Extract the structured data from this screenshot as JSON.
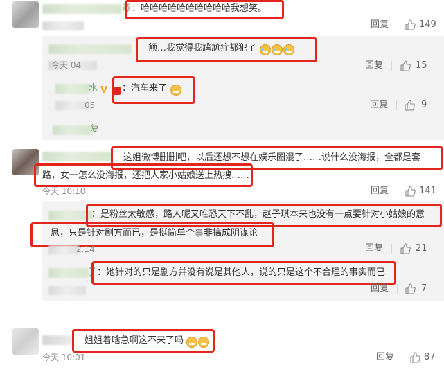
{
  "actions": {
    "reply_label": "回复"
  },
  "colors": {
    "highlight_box": "#e2261e",
    "time_text": "#8d8d8d",
    "name_green": "#6a9a5b"
  },
  "comments": [
    {
      "name_tail": "意",
      "text": "：哈哈哈哈哈哈哈哈哈哈我想笑。",
      "likes": "149"
    },
    {
      "text_line1": "这姐微博删删吧，以后还想不想在娱乐圈混了……说什么没海报，全都是套",
      "text_line2": "路，女一怎么没海报，还把人家小姑娘送上热搜……",
      "time": "今天 10:10",
      "likes": "141"
    },
    {
      "text": "姐姐着啥急啊这不来了吗",
      "time": "今天 10:01",
      "likes": "87"
    }
  ],
  "replies_1": [
    {
      "text": "额…我觉得我尴尬症都犯了",
      "time_fragment": "今天 04",
      "likes": "15"
    },
    {
      "name_tail": "水",
      "v_badge": "V",
      "text": "：汽车来了",
      "time_fragment": "05",
      "likes": "9"
    }
  ],
  "replies_1_more": "复",
  "replies_2": [
    {
      "text_line1": "：是粉丝太敏感，路人呢又唯恐天下不乱，赵子琪本来也没有一点要针对小姑娘的意",
      "text_line2": "思，只是针对剧方而已，是挺简单个事非搞成阴谋论",
      "time_fragment": "2.14",
      "likes": "21"
    },
    {
      "name_tail": "子",
      "text": "：她针对的只是剧方并没有说是其他人，说的只是这个不合理的事实而已",
      "likes": "7"
    }
  ],
  "icons": {
    "like": "thumbs-up-icon",
    "emoji_cry": "laughing-tears-emoji-icon",
    "emoji_grin": "grinning-emoji-icon"
  }
}
